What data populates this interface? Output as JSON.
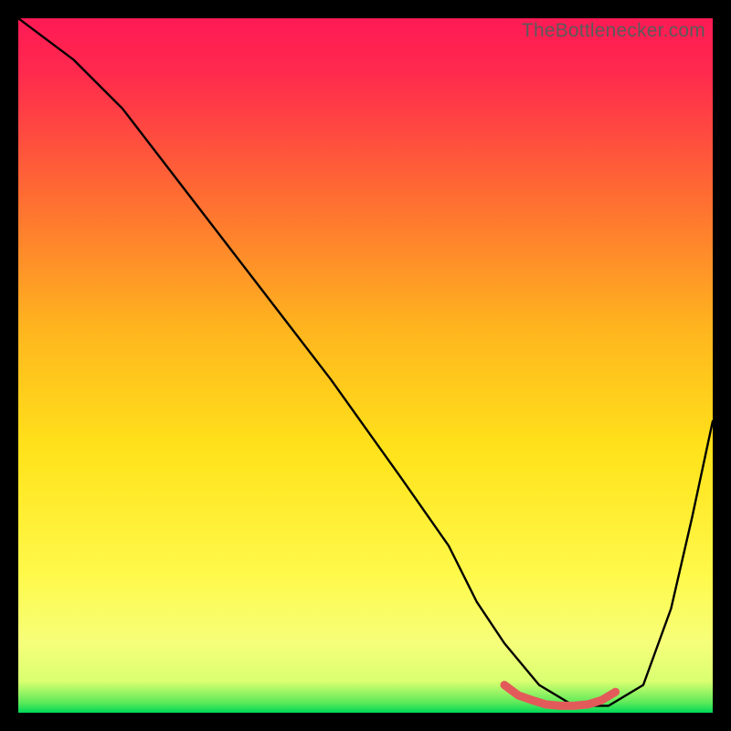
{
  "watermark": "TheBottlenecker.com",
  "chart_data": {
    "type": "line",
    "title": "",
    "xlabel": "",
    "ylabel": "",
    "xlim": [
      0,
      100
    ],
    "ylim": [
      0,
      100
    ],
    "grid": false,
    "gradient": {
      "top": "#ff1a4d",
      "mid_upper": "#ff6a33",
      "mid": "#ffd400",
      "mid_lower": "#ffff60",
      "bottom": "#00e05a"
    },
    "series": [
      {
        "name": "bottleneck-curve",
        "x": [
          0,
          4,
          8,
          15,
          25,
          35,
          45,
          55,
          62,
          66,
          70,
          75,
          80,
          85,
          90,
          94,
          97,
          100
        ],
        "y": [
          100,
          97,
          94,
          87,
          74,
          61,
          48,
          34,
          24,
          16,
          10,
          4,
          1,
          1,
          4,
          15,
          28,
          42
        ]
      }
    ],
    "markers": {
      "name": "bottom-segment",
      "color": "#e35a5a",
      "x": [
        70,
        72,
        74,
        76,
        78,
        80,
        82,
        84,
        86
      ],
      "y": [
        4,
        2.5,
        1.8,
        1.2,
        1.0,
        1.0,
        1.2,
        1.8,
        3.0
      ]
    }
  }
}
